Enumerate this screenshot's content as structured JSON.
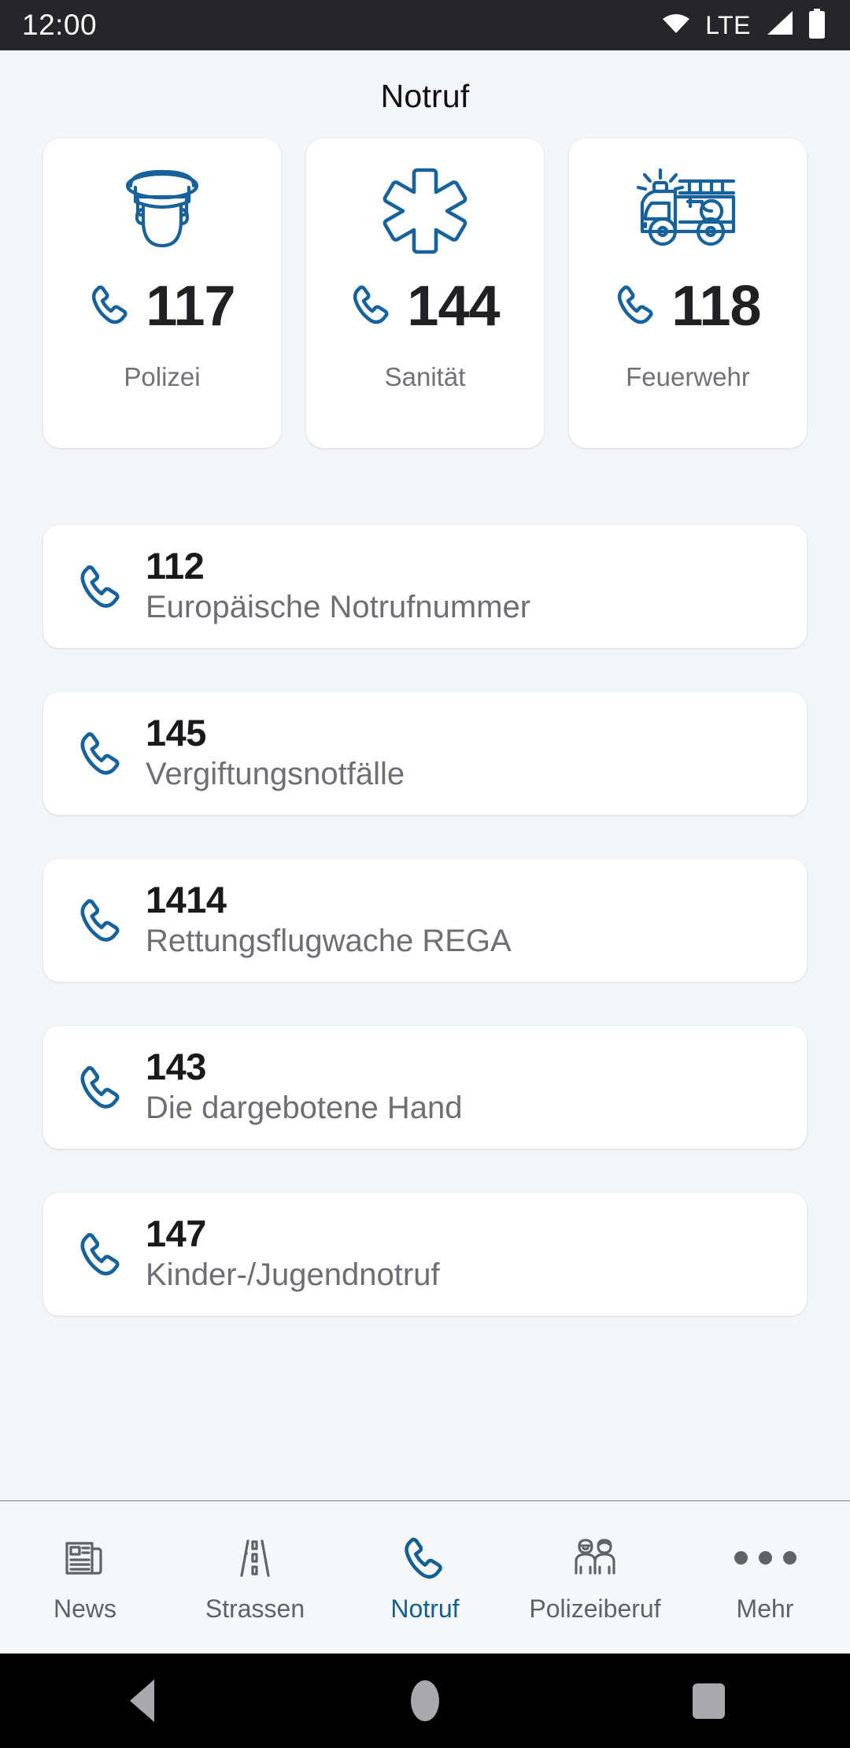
{
  "statusbar": {
    "clock": "12:00",
    "network_label": "LTE",
    "icons": [
      "wifi-icon",
      "signal-icon",
      "battery-icon"
    ]
  },
  "header": {
    "title": "Notruf"
  },
  "emergency_cards": [
    {
      "icon": "police-officer-icon",
      "number": "117",
      "label": "Polizei",
      "call_icon": "phone-icon"
    },
    {
      "icon": "star-of-life-icon",
      "number": "144",
      "label": "Sanität",
      "call_icon": "phone-icon"
    },
    {
      "icon": "fire-truck-icon",
      "number": "118",
      "label": "Feuerwehr",
      "call_icon": "phone-icon"
    }
  ],
  "emergency_list": [
    {
      "icon": "phone-icon",
      "number": "112",
      "subtitle": "Europäische Notrufnummer"
    },
    {
      "icon": "phone-icon",
      "number": "145",
      "subtitle": "Vergiftungsnotfälle"
    },
    {
      "icon": "phone-icon",
      "number": "1414",
      "subtitle": "Rettungsflugwache REGA"
    },
    {
      "icon": "phone-icon",
      "number": "143",
      "subtitle": "Die dargebotene Hand"
    },
    {
      "icon": "phone-icon",
      "number": "147",
      "subtitle": "Kinder-/Jugendnotruf"
    }
  ],
  "bottom_nav": {
    "active_index": 2,
    "items": [
      {
        "icon": "newspaper-icon",
        "label": "News"
      },
      {
        "icon": "road-icon",
        "label": "Strassen"
      },
      {
        "icon": "phone-icon",
        "label": "Notruf"
      },
      {
        "icon": "two-people-icon",
        "label": "Polizeiberuf"
      },
      {
        "icon": "ellipsis-icon",
        "label": "Mehr"
      }
    ]
  },
  "system_nav": {
    "back": "back-triangle-icon",
    "home": "home-circle-icon",
    "recents": "recents-square-icon"
  },
  "colors": {
    "accent_blue": "#17629b",
    "active_nav": "#12608f",
    "background": "#f4f5f7",
    "card": "#ffffff",
    "number_text": "#1a1a1d",
    "subtitle_text": "#6d6f73",
    "statusbar": "#262629"
  }
}
